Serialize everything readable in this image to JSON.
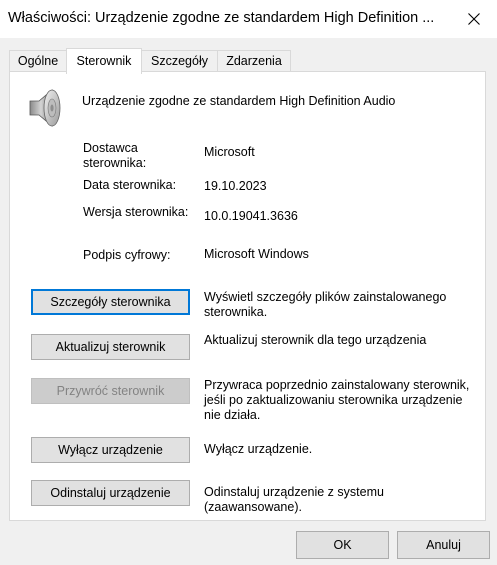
{
  "window": {
    "title": "Właściwości: Urządzenie zgodne ze standardem High Definition ...",
    "close_icon": "close-icon"
  },
  "tabs": [
    {
      "label": "Ogólne",
      "active": false
    },
    {
      "label": "Sterownik",
      "active": true
    },
    {
      "label": "Szczegóły",
      "active": false
    },
    {
      "label": "Zdarzenia",
      "active": false
    }
  ],
  "device": {
    "icon": "speaker-icon",
    "name": "Urządzenie zgodne ze standardem High Definition Audio"
  },
  "driver_info": {
    "provider_label": "Dostawca sterownika:",
    "provider_value": "Microsoft",
    "date_label": "Data sterownika:",
    "date_value": "19.10.2023",
    "version_label": "Wersja sterownika:",
    "version_value": "10.0.19041.3636",
    "signer_label": "Podpis cyfrowy:",
    "signer_value": "Microsoft Windows"
  },
  "actions": [
    {
      "label": "Szczegóły sterownika",
      "description": "Wyświetl szczegóły plików zainstalowanego sterownika.",
      "enabled": true,
      "focused": true
    },
    {
      "label": "Aktualizuj sterownik",
      "description": "Aktualizuj sterownik dla tego urządzenia",
      "enabled": true,
      "focused": false
    },
    {
      "label": "Przywróć sterownik",
      "description": "Przywraca poprzednio zainstalowany sterownik, jeśli po zaktualizowaniu sterownika urządzenie nie działa.",
      "enabled": false,
      "focused": false
    },
    {
      "label": "Wyłącz urządzenie",
      "description": "Wyłącz urządzenie.",
      "enabled": true,
      "focused": false
    },
    {
      "label": "Odinstaluj urządzenie",
      "description": "Odinstaluj urządzenie z systemu (zaawansowane).",
      "enabled": true,
      "focused": false
    }
  ],
  "footer": {
    "ok_label": "OK",
    "cancel_label": "Anuluj"
  }
}
